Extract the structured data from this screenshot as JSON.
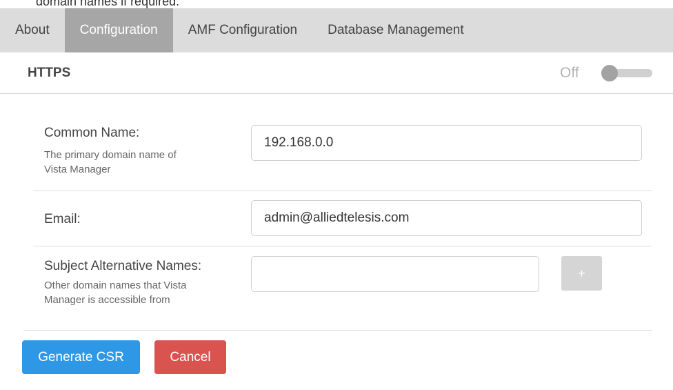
{
  "caption": "domain names if required.",
  "tabs": [
    {
      "label": "About",
      "active": false
    },
    {
      "label": "Configuration",
      "active": true
    },
    {
      "label": "AMF Configuration",
      "active": false
    },
    {
      "label": "Database Management",
      "active": false
    }
  ],
  "https": {
    "title": "HTTPS",
    "toggle_state": "Off",
    "enabled": false
  },
  "form": {
    "common_name": {
      "label": "Common Name:",
      "description_line1": "The primary domain name of",
      "description_line2": "Vista Manager",
      "value": "192.168.0.0"
    },
    "email": {
      "label": "Email:",
      "value": "admin@alliedtelesis.com"
    },
    "san": {
      "label": "Subject Alternative Names:",
      "description_line1": "Other domain names that Vista",
      "description_line2": "Manager is accessible from",
      "value": "",
      "add_label": "+"
    }
  },
  "actions": {
    "generate_label": "Generate CSR",
    "cancel_label": "Cancel"
  },
  "colors": {
    "primary": "#2f98e6",
    "danger": "#d9534f",
    "active_tab": "#a6a6a6",
    "tab_bar": "#dcdcdc"
  }
}
